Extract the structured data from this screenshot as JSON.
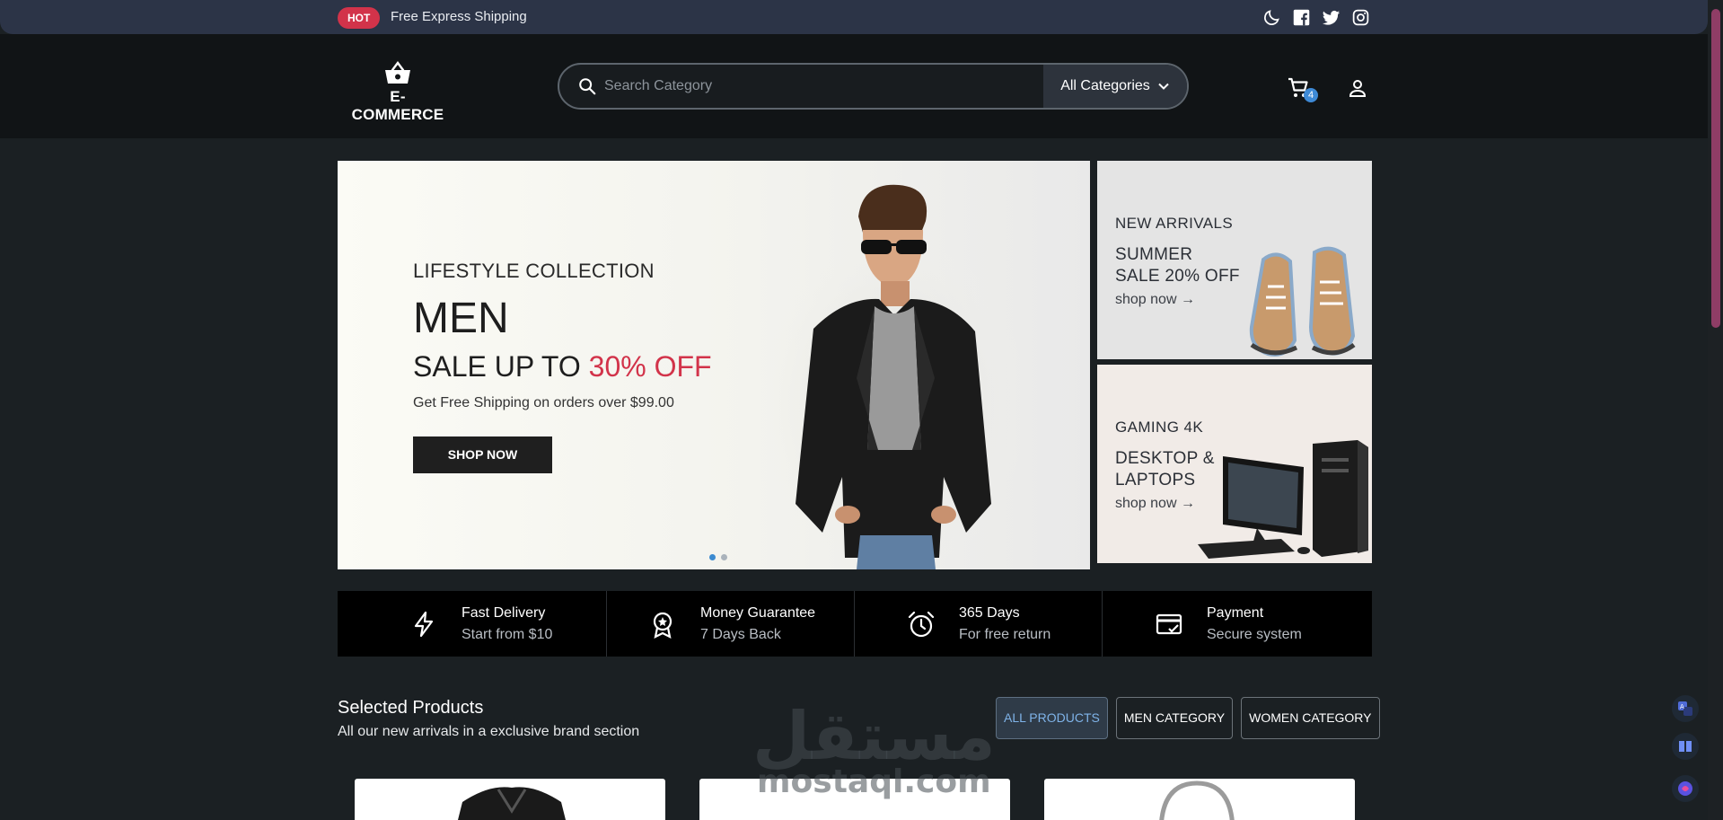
{
  "topbar": {
    "hot_label": "HOT",
    "shipping_text": "Free Express Shipping",
    "icons": [
      "moon-icon",
      "facebook-icon",
      "twitter-icon",
      "instagram-icon"
    ]
  },
  "header": {
    "logo_text": "E-COMMERCE",
    "search_placeholder": "Search Category",
    "categories_label": "All Categories",
    "cart_count": "4"
  },
  "hero": {
    "subtitle": "LIFESTYLE COLLECTION",
    "title": "MEN",
    "sale_prefix": "SALE UP TO ",
    "sale_highlight": "30% OFF",
    "note": "Get Free Shipping on orders over $99.00",
    "button": "SHOP NOW",
    "slide_count": 2,
    "active_slide": 1
  },
  "banners": [
    {
      "small": "NEW ARRIVALS",
      "line1": "SUMMER",
      "line2": "SALE 20% OFF",
      "link": "shop now →"
    },
    {
      "small": "GAMING 4K",
      "line1": "DESKTOP &",
      "line2": "LAPTOPS",
      "link": "shop now →"
    }
  ],
  "features": [
    {
      "icon": "lightning-icon",
      "title": "Fast Delivery",
      "sub": "Start from $10"
    },
    {
      "icon": "award-icon",
      "title": "Money Guarantee",
      "sub": "7 Days Back"
    },
    {
      "icon": "alarm-clock-icon",
      "title": "365 Days",
      "sub": "For free return"
    },
    {
      "icon": "credit-card-icon",
      "title": "Payment",
      "sub": "Secure system"
    }
  ],
  "products": {
    "title": "Selected Products",
    "subtitle": "All our new arrivals in a exclusive brand section",
    "filters": [
      "ALL PRODUCTS",
      "MEN CATEGORY",
      "WOMEN CATEGORY"
    ],
    "active_filter": "ALL PRODUCTS"
  },
  "watermark": {
    "arabic": "مستقل",
    "latin": "mostaql.com"
  },
  "colors": {
    "accent_red": "#d2334a",
    "topbar": "#2c3447",
    "header": "#111416",
    "page": "#1b2023",
    "badge_blue": "#3e8ad6"
  }
}
